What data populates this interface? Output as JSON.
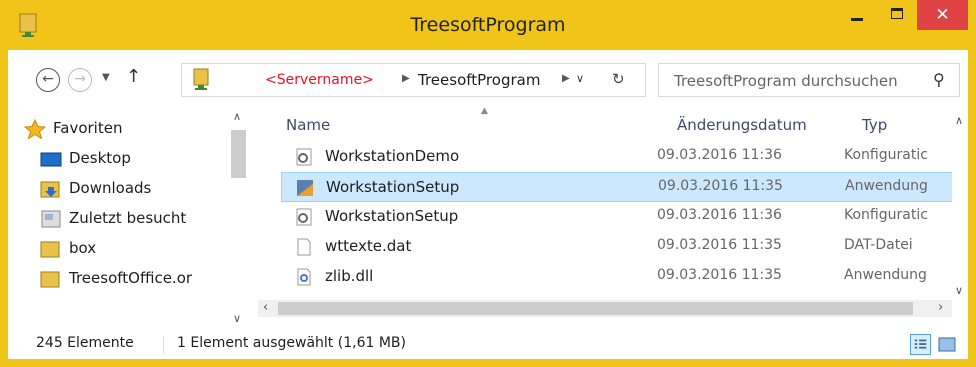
{
  "window": {
    "title": "TreesoftProgram"
  },
  "titlebar": {
    "minimize_icon": "minimize-icon",
    "maximize_icon": "maximize-icon",
    "close_label": "✕"
  },
  "address": {
    "root": "<Servername>",
    "current": "TreesoftProgram",
    "search_placeholder": "TreesoftProgram durchsuchen"
  },
  "nav": {
    "items": [
      {
        "label": "Favoriten",
        "icon": "star-icon"
      },
      {
        "label": "Desktop",
        "icon": "desktop-icon"
      },
      {
        "label": "Downloads",
        "icon": "downloads-folder-icon"
      },
      {
        "label": "Zuletzt besucht",
        "icon": "recent-places-icon"
      },
      {
        "label": "box",
        "icon": "folder-icon"
      },
      {
        "label": "TreesoftOffice.or",
        "icon": "folder-icon"
      }
    ]
  },
  "columns": {
    "name": "Name",
    "date": "Änderungsdatum",
    "type": "Typ"
  },
  "files": [
    {
      "name": "WorkstationDemo",
      "date": "09.03.2016 11:36",
      "type": "Konfiguratic",
      "icon": "config-file-icon"
    },
    {
      "name": "WorkstationSetup",
      "date": "09.03.2016 11:35",
      "type": "Anwendung",
      "icon": "setup-application-icon"
    },
    {
      "name": "WorkstationSetup",
      "date": "09.03.2016 11:36",
      "type": "Konfiguratic",
      "icon": "config-file-icon"
    },
    {
      "name": "wttexte.dat",
      "date": "09.03.2016 11:35",
      "type": "DAT-Datei",
      "icon": "blank-file-icon"
    },
    {
      "name": "zlib.dll",
      "date": "09.03.2016 11:35",
      "type": "Anwendung",
      "icon": "dll-file-icon"
    }
  ],
  "status": {
    "count": "245 Elemente",
    "selection": "1 Element ausgewählt (1,61 MB)"
  },
  "colors": {
    "accent": "#f0c419",
    "selection": "#cce8ff",
    "close": "#e04343",
    "servername": "#e81123"
  }
}
